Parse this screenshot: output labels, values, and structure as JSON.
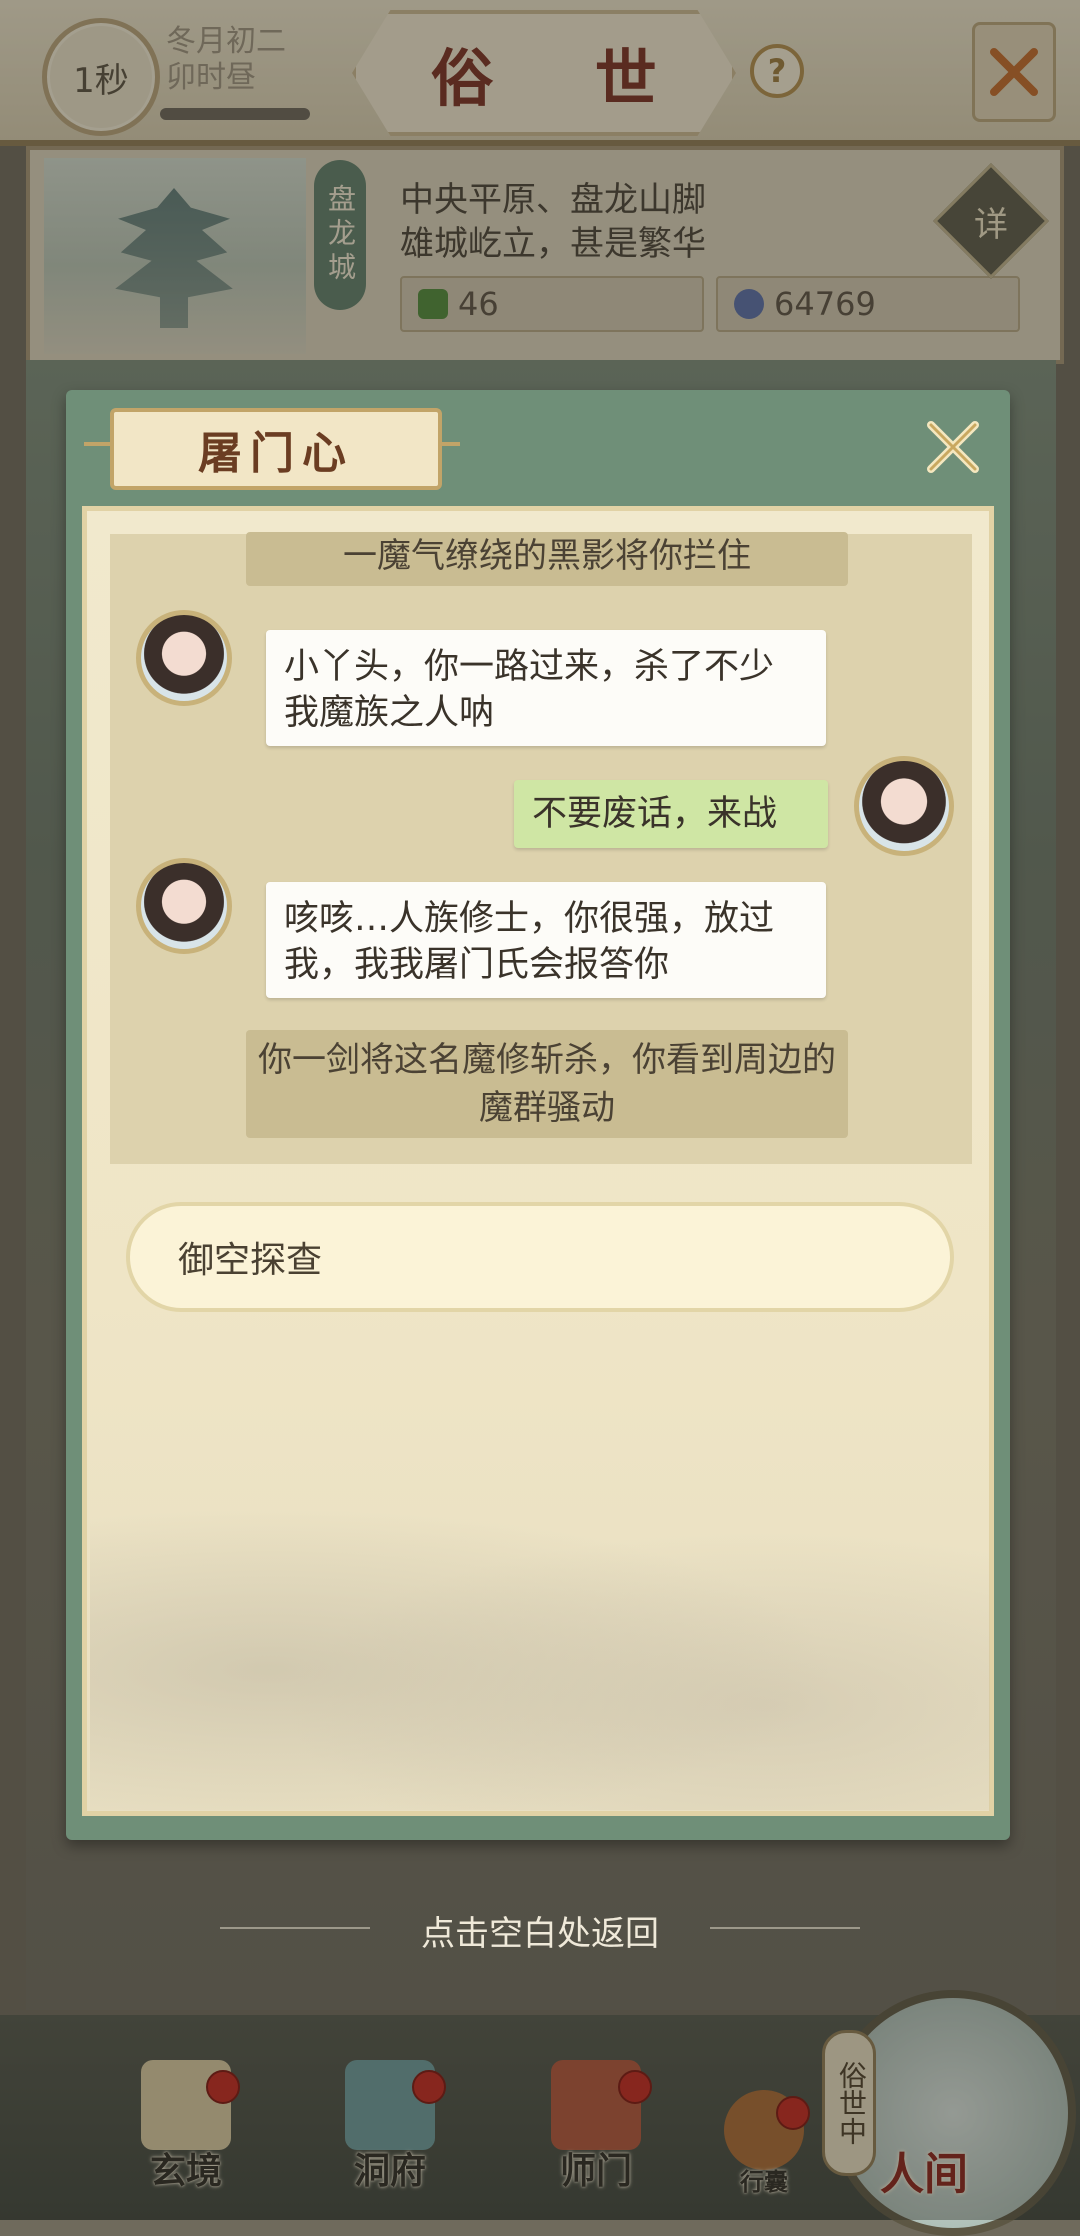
{
  "header": {
    "timer": "1秒",
    "date_line1": "冬月初二",
    "date_line2": "卯时昼",
    "title": "俗 世",
    "help": "?"
  },
  "city": {
    "name": "盘龙城",
    "desc_line1": "中央平原、盘龙山脚",
    "desc_line2": "雄城屹立，甚是繁华",
    "resource1": "46",
    "resource2": "64769",
    "detail": "详"
  },
  "dialog": {
    "title": "屠门心",
    "messages": [
      {
        "type": "narration",
        "text": "一魔气缭绕的黑影将你拦住"
      },
      {
        "type": "npc",
        "text": "小丫头，你一路过来，杀了不少我魔族之人呐"
      },
      {
        "type": "player",
        "text": "不要废话，来战"
      },
      {
        "type": "npc",
        "text": "咳咳…人族修士，你很强，放过我，我我屠门氏会报答你"
      },
      {
        "type": "narration",
        "text": "你一剑将这名魔修斩杀，你看到周边的魔群骚动"
      }
    ],
    "choice": "御空探查",
    "back_hint": "点击空白处返回"
  },
  "nav": {
    "xuanjing": "玄境",
    "dongfu": "洞府",
    "shimen": "师门",
    "xingnang": "行囊",
    "renjian": "人间",
    "sushi_side": "俗世中"
  },
  "colors": {
    "panel_green": "#6f8f78",
    "paper": "#f1e9cd",
    "player_bubble": "#cfe6a4",
    "title_red": "#7a2f22"
  }
}
